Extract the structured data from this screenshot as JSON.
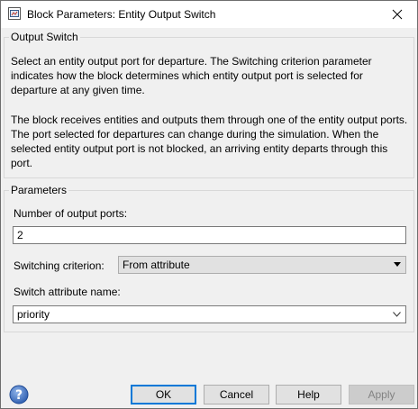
{
  "window": {
    "title": "Block Parameters: Entity Output Switch"
  },
  "description_group": {
    "legend": "Output Switch",
    "paragraph1": "Select an entity output port for departure. The Switching criterion parameter indicates how the block determines which entity output port is selected for departure at any given time.",
    "paragraph2": "The block receives entities and outputs them through one of the entity output ports. The port selected for departures can change during the simulation. When the selected entity output port is not blocked, an arriving entity departs through this port."
  },
  "parameters_group": {
    "legend": "Parameters",
    "num_ports_label": "Number of output ports:",
    "num_ports_value": "2",
    "switching_label": "Switching criterion:",
    "switching_value": "From attribute",
    "attr_label": "Switch attribute name:",
    "attr_value": "priority"
  },
  "buttons": {
    "ok": "OK",
    "cancel": "Cancel",
    "help": "Help",
    "apply": "Apply"
  },
  "icons": {
    "title": "block-parameters-icon",
    "close": "close-icon",
    "help": "help-icon"
  },
  "colors": {
    "accent": "#0078d7",
    "window_bg": "#f0f0f0",
    "help_icon": "#3a6fc4"
  }
}
